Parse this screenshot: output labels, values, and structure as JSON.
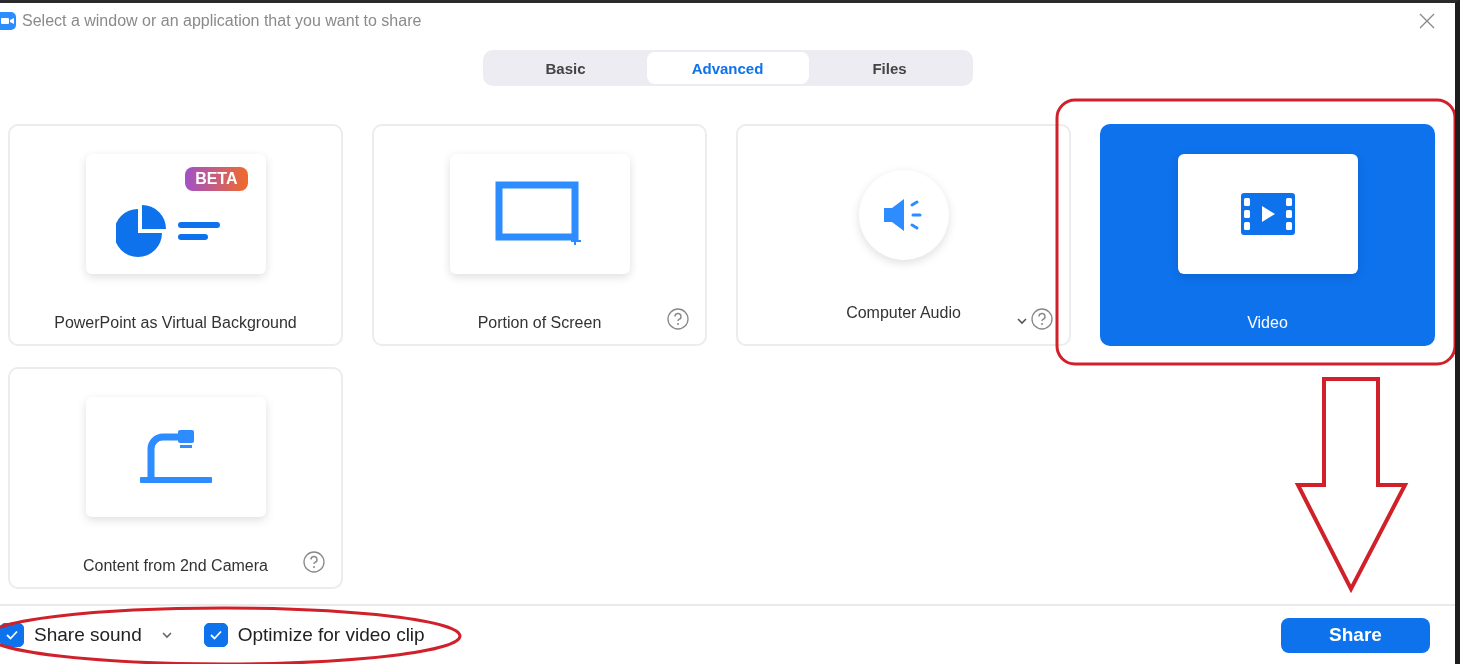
{
  "window": {
    "title": "Select a window or an application that you want to share"
  },
  "tabs": [
    {
      "label": "Basic",
      "selected": false
    },
    {
      "label": "Advanced",
      "selected": true
    },
    {
      "label": "Files",
      "selected": false
    }
  ],
  "tiles": [
    {
      "kind": "powerpoint",
      "label": "PowerPoint as Virtual Background",
      "badge": "BETA",
      "selected": false,
      "help": false,
      "dropdown": false
    },
    {
      "kind": "portion",
      "label": "Portion of Screen",
      "selected": false,
      "help": true,
      "dropdown": false
    },
    {
      "kind": "audio",
      "label": "Computer Audio",
      "selected": false,
      "help": true,
      "dropdown": true
    },
    {
      "kind": "video",
      "label": "Video",
      "selected": true,
      "help": false,
      "dropdown": false
    },
    {
      "kind": "camera",
      "label": "Content from 2nd Camera",
      "selected": false,
      "help": true,
      "dropdown": false
    }
  ],
  "options": [
    {
      "label": "Share sound",
      "checked": true,
      "dropdown": true
    },
    {
      "label": "Optimize for video clip",
      "checked": true,
      "dropdown": false
    }
  ],
  "share_button": "Share"
}
